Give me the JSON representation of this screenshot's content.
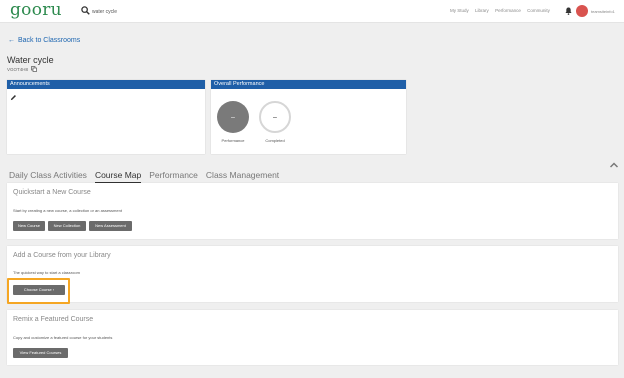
{
  "header": {
    "logo": "gooru",
    "search_value": "water cycle",
    "nav_links": [
      "My Study",
      "Library",
      "Performance",
      "Community"
    ],
    "username": "teamsiteinfo1",
    "avatar_color": "#d9534f"
  },
  "back_link": "Back to Classrooms",
  "class": {
    "title": "Water cycle",
    "code": "VGOT4H8"
  },
  "announcements": {
    "title": "Announcements"
  },
  "overall_performance": {
    "title": "Overall Performance",
    "performance_value": "–",
    "performance_label": "Performance",
    "completed_value": "–",
    "completed_label": "Completed"
  },
  "tabs": [
    "Daily Class Activities",
    "Course Map",
    "Performance",
    "Class Management"
  ],
  "active_tab": "Course Map",
  "quickstart": {
    "title": "Quickstart a New Course",
    "description": "Start by creating a new course, a collection or an assessment",
    "buttons": [
      "New Course",
      "New Collection",
      "New Assessment"
    ]
  },
  "add_course": {
    "title": "Add a Course from your Library",
    "description": "The quickest way to start a classroom",
    "button": "Choose Course ›"
  },
  "remix": {
    "title": "Remix a Featured Course",
    "description": "Copy and customize a featured course for your students",
    "button": "View Featured Courses"
  },
  "colors": {
    "brand_green": "#2d8a4e",
    "panel_blue": "#1f5fa8",
    "link_blue": "#1e66b0",
    "highlight": "#f5a623"
  }
}
